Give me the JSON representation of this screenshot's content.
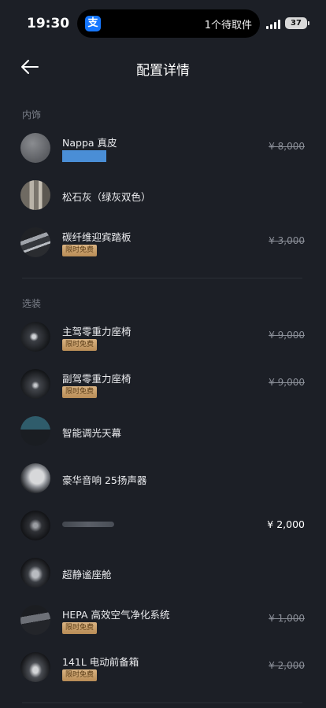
{
  "status_bar": {
    "time": "19:30",
    "app_glyph": "支",
    "activity_text": "1个待取件",
    "battery": "37",
    "icons": [
      "alipay-icon",
      "signal-icon",
      "battery-icon"
    ]
  },
  "nav": {
    "title": "配置详情",
    "back_icon": "arrow-left-icon"
  },
  "sections": {
    "interior": {
      "title": "内饰",
      "items": [
        {
          "name": "Nappa 真皮",
          "price": "¥ 8,000"
        },
        {
          "name": "松石灰（绿灰双色）"
        },
        {
          "name": "碳纤维迎宾踏板",
          "badge": "限时免费",
          "price": "¥ 3,000"
        }
      ]
    },
    "options": {
      "title": "选装",
      "items": [
        {
          "name": "主驾零重力座椅",
          "badge": "限时免费",
          "price": "¥ 9,000"
        },
        {
          "name": "副驾零重力座椅",
          "badge": "限时免费",
          "price": "¥ 9,000"
        },
        {
          "name": "智能调光天幕"
        },
        {
          "name": "豪华音响 25扬声器"
        },
        {
          "price": "¥ 2,000"
        },
        {
          "name": "超静谧座舱"
        },
        {
          "name": "HEPA 高效空气净化系统",
          "badge": "限时免费",
          "price": "¥ 1,000"
        },
        {
          "name": "141L 电动前备箱",
          "badge": "限时免费",
          "price": "¥ 2,000"
        }
      ]
    }
  },
  "colors": {
    "background": "#1c1f26",
    "badge_gold": "#c9a06b",
    "redaction_blue": "#4a8ed6"
  }
}
